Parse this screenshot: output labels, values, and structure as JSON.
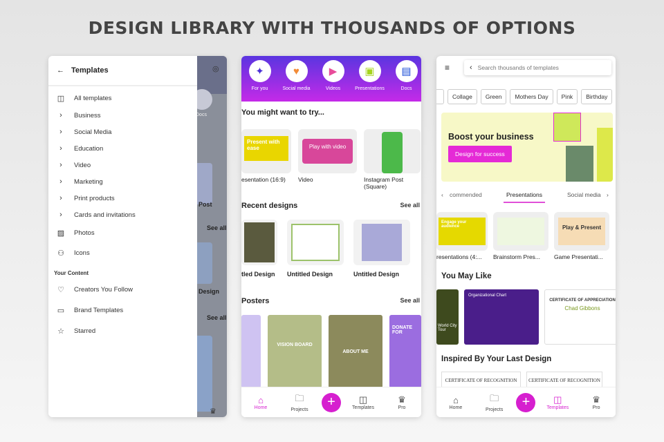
{
  "headline": "DESIGN LIBRARY WITH THOUSANDS OF OPTIONS",
  "panel1": {
    "header": {
      "back_icon": "arrow-left",
      "title": "Templates"
    },
    "all_templates": "All templates",
    "categories": [
      "Business",
      "Social Media",
      "Education",
      "Video",
      "Marketing",
      "Print products",
      "Cards and invitations"
    ],
    "photos": "Photos",
    "icons": "Icons",
    "your_content_heading": "Your Content",
    "your_content": [
      "Creators You Follow",
      "Brand Templates",
      "Starred"
    ],
    "behind": {
      "docs": "Docs",
      "post": "Post",
      "see_all_1": "See all",
      "design": "Design",
      "see_all_2": "See all"
    }
  },
  "panel2": {
    "categories": [
      {
        "label": "For you",
        "icon": "✦",
        "color": "#4b2fd6"
      },
      {
        "label": "Social media",
        "icon": "♥",
        "color": "#f28c38"
      },
      {
        "label": "Videos",
        "icon": "▶",
        "color": "#e84c9a"
      },
      {
        "label": "Presentations",
        "icon": "▣",
        "color": "#a6d41e"
      },
      {
        "label": "Docs",
        "icon": "▤",
        "color": "#1e4fd8"
      }
    ],
    "try_heading": "You might want to try...",
    "try_items": [
      "esentation (16:9)",
      "Video",
      "Instagram Post (Square)"
    ],
    "try_thumb_text": [
      "Present with ease",
      "Play with video"
    ],
    "recent_heading": "Recent designs",
    "recent_see_all": "See all",
    "recent_items": [
      "tled Design",
      "Untitled Design",
      "Untitled Design"
    ],
    "posters_heading": "Posters",
    "posters_see_all": "See all",
    "poster_texts": [
      "VISION BOARD",
      "ABOUT ME",
      "DONATE FOR"
    ]
  },
  "panel3": {
    "search_placeholder": "Search thousands of templates",
    "chips": [
      "Collage",
      "Green",
      "Mothers Day",
      "Pink",
      "Birthday"
    ],
    "banner": {
      "title": "Boost your business",
      "button": "Design for success",
      "colors": {
        "bg": "#f7f8c7",
        "button": "#e52ad6"
      }
    },
    "tabs": [
      "commended",
      "Presentations",
      "Social media"
    ],
    "pres_items": [
      "resentations (4:...",
      "Brainstorm Pres...",
      "Game Presentati..."
    ],
    "pres_thumb_text": [
      "Engage your audience",
      "Play & Present"
    ],
    "you_may_like": "You May Like",
    "like_texts": [
      "World City Tour",
      "Organizational Chart",
      "CERTIFICATE OF APPRECIATION",
      "Chad Gibbons"
    ],
    "inspired": "Inspired By Your Last Design",
    "inspired_texts": [
      "CERTIFICATE OF RECOGNITION",
      "CERTIFICATE OF RECOGNITION"
    ]
  },
  "nav": {
    "home": "Home",
    "projects": "Projects",
    "templates": "Templates",
    "pro": "Pro"
  },
  "accent": "#d61fcf"
}
